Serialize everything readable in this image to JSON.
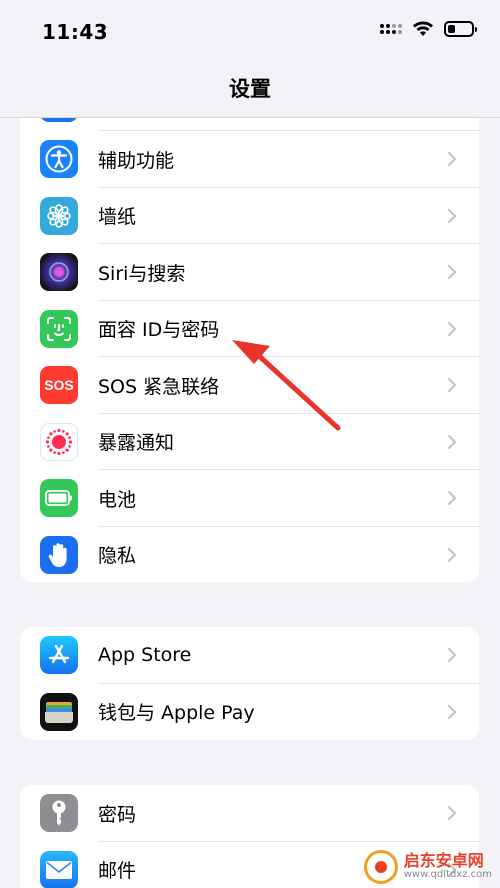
{
  "status_bar": {
    "time": "11:43"
  },
  "nav": {
    "title": "设置"
  },
  "group1": {
    "items": [
      {
        "label": "辅助功能",
        "icon": "accessibility-icon",
        "color": "#1a82fb"
      },
      {
        "label": "墙纸",
        "icon": "wallpaper-flower-icon",
        "color": "#34aadc"
      },
      {
        "label": "Siri与搜索",
        "icon": "siri-icon",
        "color": "#222222"
      },
      {
        "label": "面容 ID与密码",
        "icon": "face-id-icon",
        "color": "#34c759"
      },
      {
        "label": "SOS 紧急联络",
        "icon": "sos-icon",
        "icon_text": "SOS",
        "color": "#ff3b30"
      },
      {
        "label": "暴露通知",
        "icon": "exposure-notification-icon",
        "color": "#ffffff"
      },
      {
        "label": "电池",
        "icon": "battery-icon",
        "color": "#34c759"
      },
      {
        "label": "隐私",
        "icon": "privacy-hand-icon",
        "color": "#1a6ff0"
      }
    ]
  },
  "group2": {
    "items": [
      {
        "label": "App Store",
        "icon": "app-store-icon",
        "color": "#1a8cfb"
      },
      {
        "label": "钱包与 Apple Pay",
        "icon": "wallet-icon",
        "color": "#111111"
      }
    ]
  },
  "group3": {
    "items": [
      {
        "label": "密码",
        "icon": "key-icon",
        "color": "#8e8e93"
      },
      {
        "label": "邮件",
        "icon": "mail-icon",
        "color": "#1a8cfb"
      }
    ]
  },
  "watermark": {
    "name": "启东安卓网",
    "url": "www.qdltdxz.com"
  }
}
